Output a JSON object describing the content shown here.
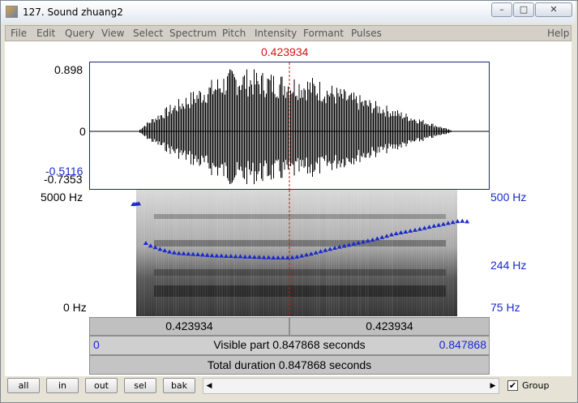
{
  "window": {
    "title": "127. Sound zhuang2",
    "controls": {
      "minimize": "–",
      "maximize": "□",
      "close": "✕"
    }
  },
  "menu": [
    "File",
    "Edit",
    "Query",
    "View",
    "Select",
    "Spectrum",
    "Pitch",
    "Intensity",
    "Formant",
    "Pulses",
    "Help"
  ],
  "cursor": {
    "time_label": "0.423934",
    "time_seconds": 0.423934
  },
  "waveform": {
    "y_max_label": "0.898",
    "y_zero_label": "0",
    "y_min_label": "-0.7353",
    "y_min_selection_label": "-0.5116"
  },
  "spectrogram": {
    "freq_max_label": "5000 Hz",
    "freq_min_label": "0 Hz",
    "pitch_top_label": "500 Hz",
    "pitch_mid_label": "244 Hz",
    "pitch_bottom_label": "75 Hz"
  },
  "pitch_track": {
    "pitch_axis_hz": [
      75,
      500
    ],
    "points": [
      [
        0.093,
        438
      ],
      [
        0.097,
        440
      ],
      [
        0.101,
        441
      ],
      [
        0.105,
        443
      ],
      [
        0.12,
        227
      ],
      [
        0.13,
        217
      ],
      [
        0.14,
        211
      ],
      [
        0.15,
        205
      ],
      [
        0.16,
        200
      ],
      [
        0.17,
        196
      ],
      [
        0.18,
        193
      ],
      [
        0.19,
        191
      ],
      [
        0.2,
        190
      ],
      [
        0.21,
        189
      ],
      [
        0.22,
        188
      ],
      [
        0.23,
        187
      ],
      [
        0.24,
        186
      ],
      [
        0.25,
        185
      ],
      [
        0.26,
        184
      ],
      [
        0.27,
        183
      ],
      [
        0.28,
        183
      ],
      [
        0.29,
        182
      ],
      [
        0.3,
        182
      ],
      [
        0.31,
        181
      ],
      [
        0.32,
        181
      ],
      [
        0.33,
        180
      ],
      [
        0.34,
        180
      ],
      [
        0.35,
        179
      ],
      [
        0.36,
        179
      ],
      [
        0.37,
        178
      ],
      [
        0.38,
        178
      ],
      [
        0.39,
        177
      ],
      [
        0.4,
        177
      ],
      [
        0.41,
        177
      ],
      [
        0.42,
        177
      ],
      [
        0.43,
        178
      ],
      [
        0.44,
        180
      ],
      [
        0.45,
        183
      ],
      [
        0.46,
        186
      ],
      [
        0.47,
        189
      ],
      [
        0.48,
        193
      ],
      [
        0.49,
        197
      ],
      [
        0.5,
        201
      ],
      [
        0.51,
        205
      ],
      [
        0.52,
        209
      ],
      [
        0.53,
        213
      ],
      [
        0.54,
        216
      ],
      [
        0.55,
        220
      ],
      [
        0.56,
        224
      ],
      [
        0.57,
        228
      ],
      [
        0.58,
        232
      ],
      [
        0.59,
        236
      ],
      [
        0.6,
        240
      ],
      [
        0.61,
        245
      ],
      [
        0.62,
        250
      ],
      [
        0.63,
        256
      ],
      [
        0.64,
        262
      ],
      [
        0.65,
        267
      ],
      [
        0.66,
        271
      ],
      [
        0.67,
        275
      ],
      [
        0.68,
        279
      ],
      [
        0.69,
        283
      ],
      [
        0.7,
        288
      ],
      [
        0.71,
        293
      ],
      [
        0.72,
        298
      ],
      [
        0.73,
        303
      ],
      [
        0.74,
        308
      ],
      [
        0.75,
        313
      ],
      [
        0.76,
        318
      ],
      [
        0.77,
        323
      ],
      [
        0.78,
        328
      ],
      [
        0.79,
        330
      ],
      [
        0.8,
        327
      ]
    ],
    "point_color": "#1a2acc"
  },
  "time_bar": {
    "left_segment_label": "0.423934",
    "right_segment_label": "0.423934",
    "visible_start_label": "0",
    "visible_end_label": "0.847868",
    "visible_part_label": "Visible part 0.847868 seconds",
    "total_duration_label": "Total duration 0.847868 seconds"
  },
  "toolbar": {
    "buttons": [
      "all",
      "in",
      "out",
      "sel",
      "bak"
    ],
    "group_label": "Group",
    "group_checked": true,
    "group_check_mark": "✔"
  },
  "scroll": {
    "left_arrow": "◀",
    "right_arrow": "▶"
  },
  "colors": {
    "cursor": "#d21414",
    "axis_label": "#000000",
    "selection_label": "#1a2acc",
    "pitch_label": "#1a2acc",
    "frame": "#1a2a6c"
  },
  "sound": {
    "total_duration_seconds": 0.847868
  }
}
